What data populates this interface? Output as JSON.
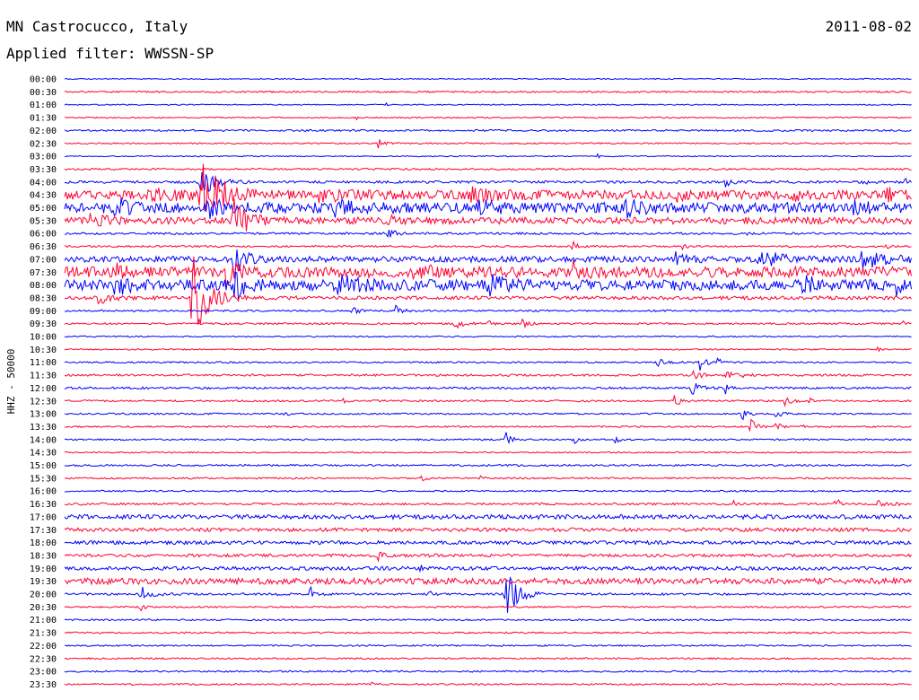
{
  "header": {
    "title": "MN Castrocucco, Italy",
    "filter": "Applied filter: WWSSN-SP",
    "date": "2011-08-02"
  },
  "chart_data": {
    "type": "helicorder",
    "channel_label": "HHZ - 50000",
    "colors": [
      "#0000ff",
      "#ff0033"
    ],
    "rows": [
      {
        "time": "00:00",
        "noise": 0.6,
        "events": []
      },
      {
        "time": "00:30",
        "noise": 0.9,
        "events": []
      },
      {
        "time": "01:00",
        "noise": 0.6,
        "events": [
          [
            0.38,
            3,
            1
          ]
        ]
      },
      {
        "time": "01:30",
        "noise": 0.7,
        "events": [
          [
            0.345,
            4,
            1
          ]
        ]
      },
      {
        "time": "02:00",
        "noise": 1.0,
        "events": []
      },
      {
        "time": "02:30",
        "noise": 0.8,
        "events": [
          [
            0.37,
            5,
            8
          ]
        ]
      },
      {
        "time": "03:00",
        "noise": 0.6,
        "events": [
          [
            0.63,
            3,
            1
          ]
        ]
      },
      {
        "time": "03:30",
        "noise": 1.0,
        "events": []
      },
      {
        "time": "04:00",
        "noise": 1.4,
        "events": [
          [
            0.16,
            18,
            14
          ],
          [
            0.78,
            5,
            6
          ],
          [
            0.94,
            4,
            5
          ],
          [
            0.99,
            8,
            3
          ]
        ]
      },
      {
        "time": "04:30",
        "noise": 5.0,
        "events": [
          [
            0.16,
            40,
            20
          ],
          [
            0.1,
            6,
            25
          ],
          [
            0.3,
            6,
            25
          ],
          [
            0.48,
            6,
            25
          ],
          [
            0.72,
            8,
            6
          ],
          [
            0.86,
            6,
            6
          ],
          [
            0.97,
            9,
            8
          ]
        ]
      },
      {
        "time": "05:00",
        "noise": 6.0,
        "events": [
          [
            0.06,
            10,
            10
          ],
          [
            0.17,
            14,
            10
          ],
          [
            0.32,
            8,
            18
          ],
          [
            0.49,
            9,
            12
          ],
          [
            0.66,
            10,
            12
          ],
          [
            0.93,
            9,
            10
          ]
        ]
      },
      {
        "time": "05:30",
        "noise": 3.8,
        "events": [
          [
            0.03,
            8,
            14
          ],
          [
            0.2,
            22,
            14
          ],
          [
            0.38,
            6,
            10
          ]
        ]
      },
      {
        "time": "06:00",
        "noise": 1.2,
        "events": [
          [
            0.38,
            6,
            8
          ],
          [
            0.8,
            5,
            3
          ]
        ]
      },
      {
        "time": "06:30",
        "noise": 1.0,
        "events": [
          [
            0.6,
            5,
            6
          ],
          [
            0.73,
            5,
            4
          ],
          [
            0.97,
            3,
            3
          ]
        ]
      },
      {
        "time": "07:00",
        "noise": 3.2,
        "events": [
          [
            0.2,
            22,
            10
          ],
          [
            0.72,
            10,
            12
          ],
          [
            0.82,
            10,
            25
          ],
          [
            0.94,
            10,
            25
          ]
        ]
      },
      {
        "time": "07:30",
        "noise": 6.0,
        "events": [
          [
            0.06,
            10,
            8
          ],
          [
            0.19,
            14,
            10
          ],
          [
            0.41,
            10,
            14
          ],
          [
            0.6,
            8,
            12
          ]
        ]
      },
      {
        "time": "08:00",
        "noise": 6.0,
        "events": [
          [
            0.06,
            12,
            10
          ],
          [
            0.2,
            20,
            10
          ],
          [
            0.32,
            10,
            20
          ],
          [
            0.5,
            9,
            14
          ],
          [
            0.87,
            10,
            12
          ],
          [
            0.98,
            10,
            8
          ]
        ]
      },
      {
        "time": "08:30",
        "noise": 2.0,
        "events": [
          [
            0.15,
            55,
            15
          ],
          [
            0.04,
            8,
            10
          ]
        ]
      },
      {
        "time": "09:00",
        "noise": 1.0,
        "events": [
          [
            0.34,
            6,
            5
          ],
          [
            0.39,
            6,
            6
          ]
        ]
      },
      {
        "time": "09:30",
        "noise": 1.0,
        "events": [
          [
            0.46,
            7,
            8
          ],
          [
            0.5,
            6,
            3
          ],
          [
            0.54,
            5,
            6
          ],
          [
            0.99,
            3,
            3
          ]
        ]
      },
      {
        "time": "10:00",
        "noise": 0.7,
        "events": []
      },
      {
        "time": "10:30",
        "noise": 0.7,
        "events": [
          [
            0.96,
            3,
            4
          ]
        ]
      },
      {
        "time": "11:00",
        "noise": 0.9,
        "events": [
          [
            0.7,
            4,
            10
          ],
          [
            0.75,
            9,
            6
          ],
          [
            0.77,
            6,
            4
          ]
        ]
      },
      {
        "time": "11:30",
        "noise": 1.2,
        "events": [
          [
            0.74,
            7,
            8
          ],
          [
            0.78,
            6,
            8
          ],
          [
            0.8,
            3,
            4
          ]
        ]
      },
      {
        "time": "12:00",
        "noise": 1.2,
        "events": [
          [
            0.74,
            8,
            8
          ],
          [
            0.78,
            6,
            4
          ]
        ]
      },
      {
        "time": "12:30",
        "noise": 1.0,
        "events": [
          [
            0.33,
            5,
            2
          ],
          [
            0.72,
            6,
            8
          ],
          [
            0.85,
            5,
            6
          ],
          [
            0.88,
            3,
            3
          ]
        ]
      },
      {
        "time": "13:00",
        "noise": 0.9,
        "events": [
          [
            0.26,
            3,
            3
          ],
          [
            0.8,
            8,
            6
          ],
          [
            0.84,
            6,
            5
          ]
        ]
      },
      {
        "time": "13:30",
        "noise": 0.9,
        "events": [
          [
            0.81,
            8,
            6
          ],
          [
            0.84,
            6,
            4
          ],
          [
            0.87,
            3,
            2
          ]
        ]
      },
      {
        "time": "14:00",
        "noise": 0.9,
        "events": [
          [
            0.52,
            9,
            6
          ],
          [
            0.6,
            6,
            4
          ],
          [
            0.65,
            3,
            6
          ]
        ]
      },
      {
        "time": "14:30",
        "noise": 0.7,
        "events": []
      },
      {
        "time": "15:00",
        "noise": 1.0,
        "events": []
      },
      {
        "time": "15:30",
        "noise": 0.9,
        "events": [
          [
            0.42,
            3,
            6
          ],
          [
            0.49,
            3,
            3
          ]
        ]
      },
      {
        "time": "16:00",
        "noise": 0.9,
        "events": []
      },
      {
        "time": "16:30",
        "noise": 1.2,
        "events": [
          [
            0.79,
            4,
            2
          ],
          [
            0.91,
            9,
            4
          ],
          [
            0.96,
            3,
            14
          ]
        ]
      },
      {
        "time": "17:00",
        "noise": 2.4,
        "events": []
      },
      {
        "time": "17:30",
        "noise": 2.0,
        "events": []
      },
      {
        "time": "18:00",
        "noise": 2.0,
        "events": []
      },
      {
        "time": "18:30",
        "noise": 1.6,
        "events": [
          [
            0.37,
            5,
            5
          ],
          [
            0.43,
            3,
            4
          ]
        ]
      },
      {
        "time": "19:00",
        "noise": 2.0,
        "events": [
          [
            0.42,
            4,
            2
          ]
        ]
      },
      {
        "time": "19:30",
        "noise": 3.4,
        "events": []
      },
      {
        "time": "20:00",
        "noise": 1.2,
        "events": [
          [
            0.09,
            9,
            10
          ],
          [
            0.25,
            5,
            3
          ],
          [
            0.29,
            9,
            6
          ],
          [
            0.43,
            4,
            4
          ],
          [
            0.52,
            30,
            12
          ]
        ]
      },
      {
        "time": "20:30",
        "noise": 0.9,
        "events": [
          [
            0.09,
            4,
            4
          ]
        ]
      },
      {
        "time": "21:00",
        "noise": 0.9,
        "events": []
      },
      {
        "time": "21:30",
        "noise": 0.9,
        "events": []
      },
      {
        "time": "22:00",
        "noise": 0.9,
        "events": []
      },
      {
        "time": "22:30",
        "noise": 0.9,
        "events": []
      },
      {
        "time": "23:00",
        "noise": 0.9,
        "events": []
      },
      {
        "time": "23:30",
        "noise": 0.9,
        "events": [
          [
            0.36,
            3,
            3
          ]
        ]
      }
    ]
  }
}
